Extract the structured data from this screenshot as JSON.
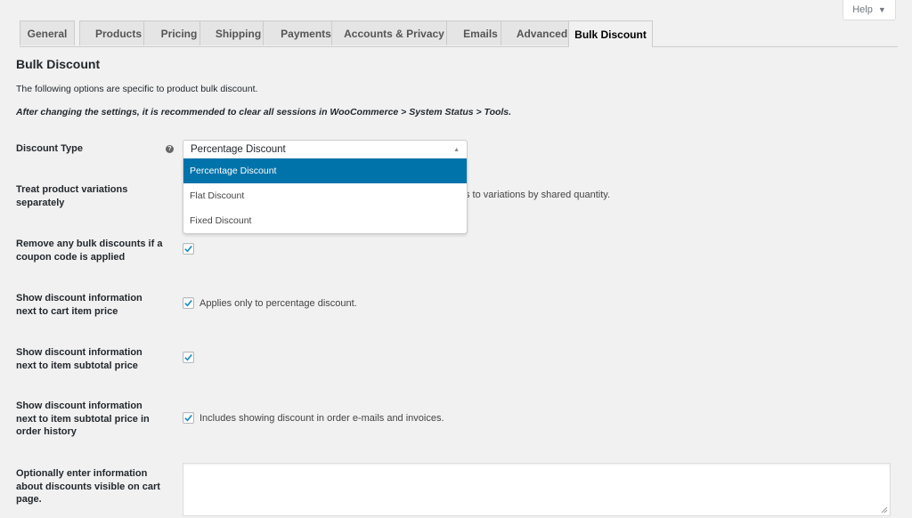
{
  "help": {
    "label": "Help",
    "caret": "▼"
  },
  "tabs": [
    {
      "label": "General"
    },
    {
      "label": "Products"
    },
    {
      "label": "Pricing"
    },
    {
      "label": "Shipping"
    },
    {
      "label": "Payments"
    },
    {
      "label": "Accounts & Privacy"
    },
    {
      "label": "Emails"
    },
    {
      "label": "Advanced"
    },
    {
      "label": "Bulk Discount",
      "active": true
    }
  ],
  "section": {
    "title": "Bulk Discount",
    "description": "The following options are specific to product bulk discount.",
    "note": "After changing the settings, it is recommended to clear all sessions in WooCommerce > System Status > Tools."
  },
  "fields": {
    "discount_type": {
      "label": "Discount Type",
      "help_icon": "question-circle-icon",
      "selected": "Percentage Discount",
      "options": [
        "Percentage Discount",
        "Flat Discount",
        "Fixed Discount"
      ]
    },
    "treat_variations": {
      "label": "Treat product variations separately",
      "hint_partial": "s to variations by shared quantity."
    },
    "remove_on_coupon": {
      "label": "Remove any bulk discounts if a coupon code is applied",
      "checked": true
    },
    "show_cart_item": {
      "label": "Show discount information next to cart item price",
      "checked": true,
      "hint": "Applies only to percentage discount."
    },
    "show_subtotal": {
      "label": "Show discount information next to item subtotal price",
      "checked": true
    },
    "show_order_history": {
      "label": "Show discount information next to item subtotal price in order history",
      "checked": true,
      "hint": "Includes showing discount in order e-mails and invoices."
    },
    "cart_info": {
      "label": "Optionally enter information about discounts visible on cart page.",
      "value": ""
    }
  },
  "colors": {
    "accent": "#0073aa",
    "background": "#f1f1f1",
    "tab_inactive": "#e5e5e5",
    "check": "#1e8cbe"
  }
}
